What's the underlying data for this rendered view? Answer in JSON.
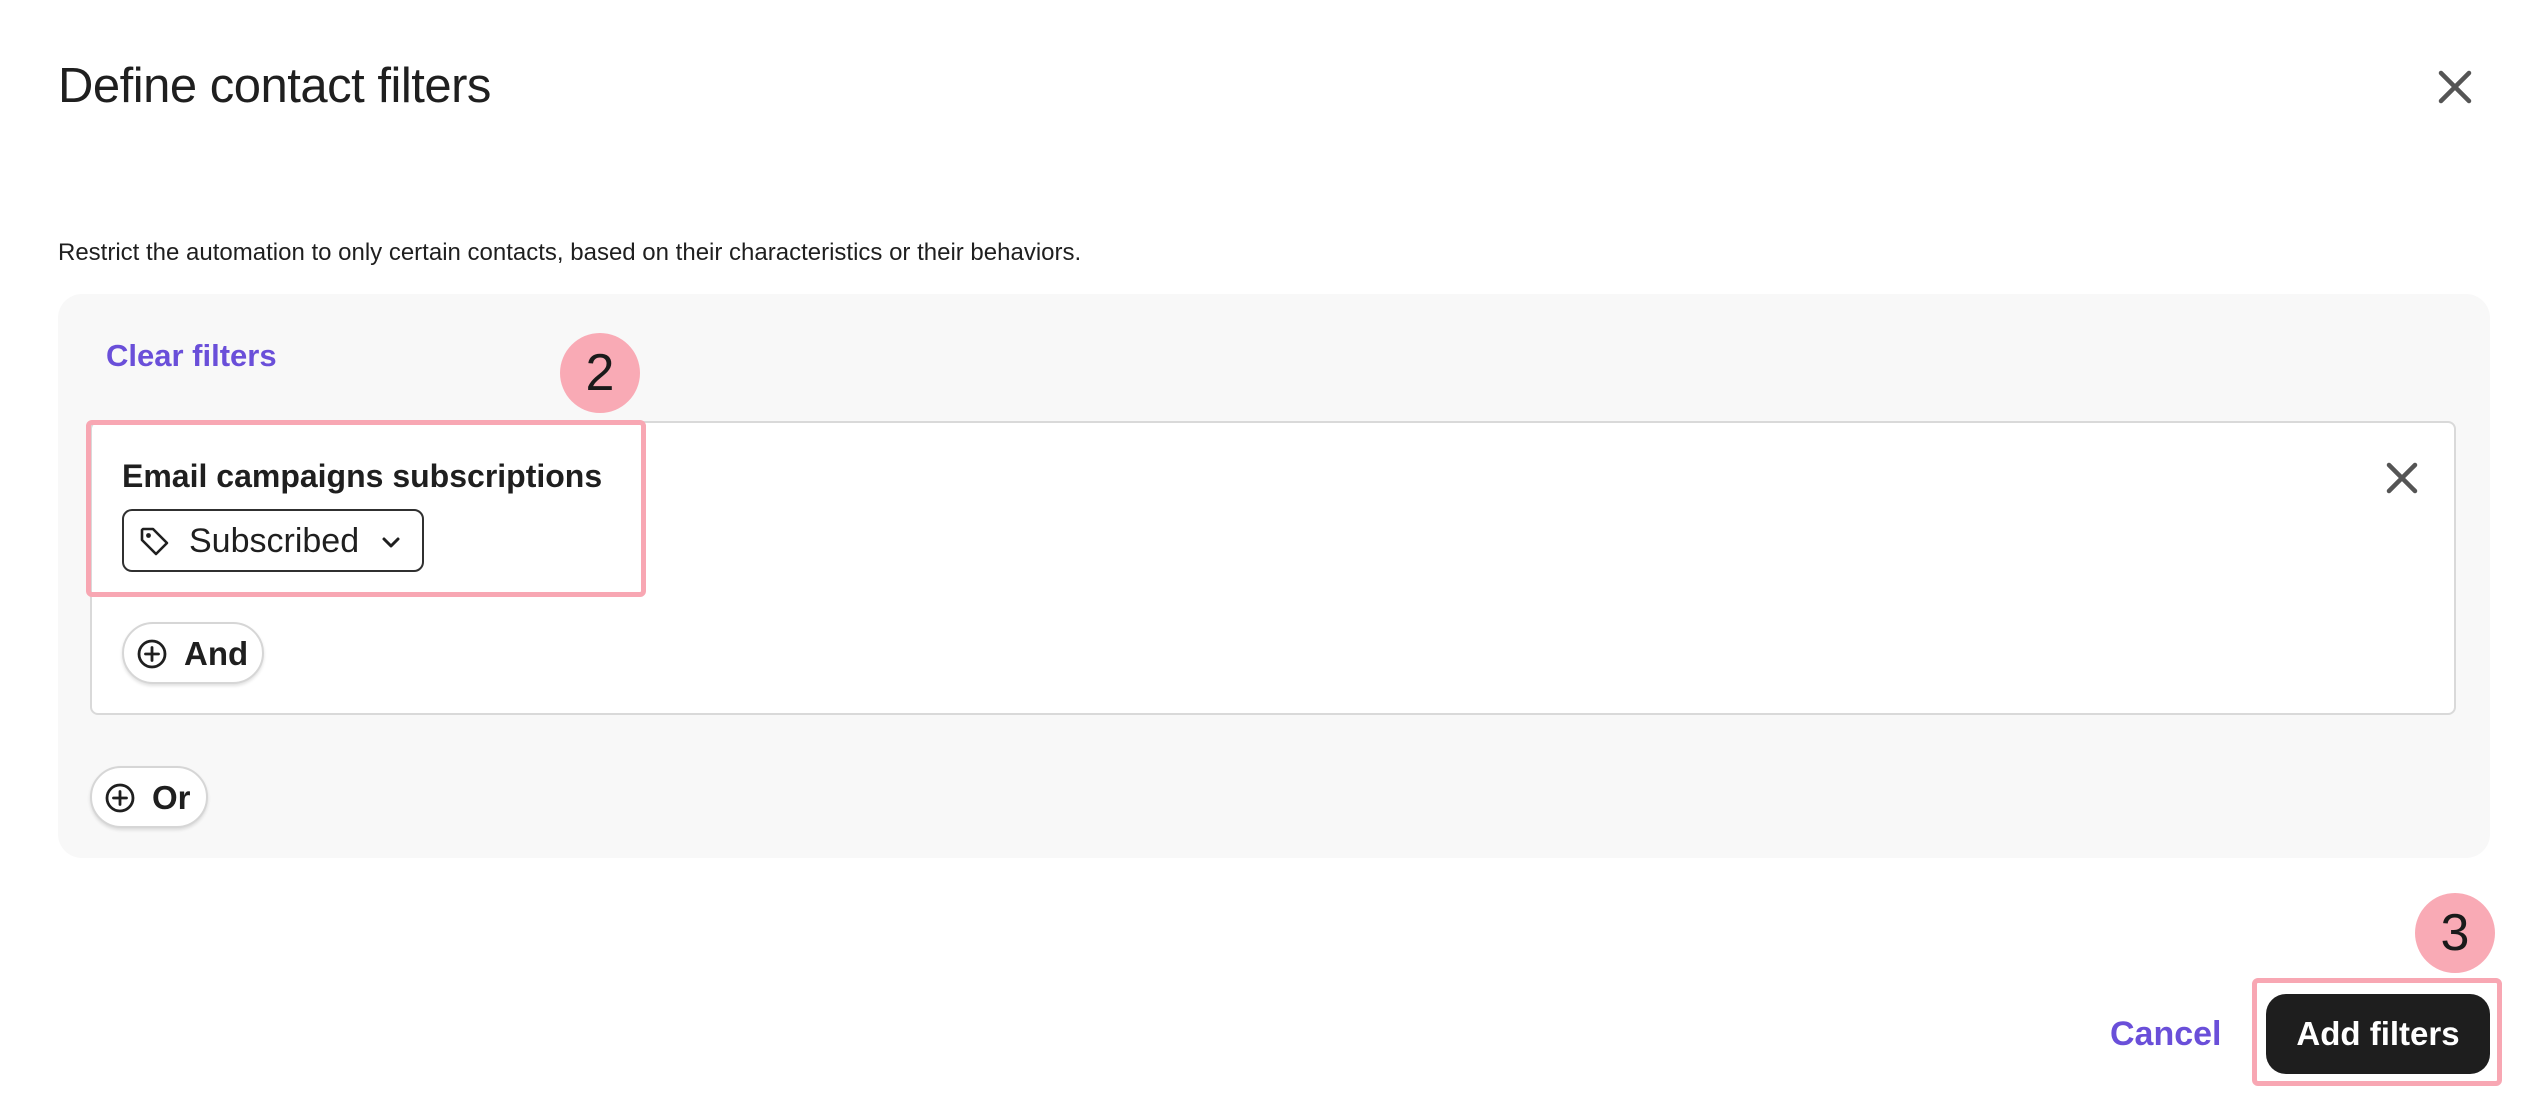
{
  "modal": {
    "title": "Define contact filters",
    "description": "Restrict the automation to only certain contacts, based on their characteristics or their behaviors."
  },
  "filters": {
    "clear_label": "Clear filters",
    "groups": [
      {
        "conditions": [
          {
            "title": "Email campaigns subscriptions",
            "value": "Subscribed",
            "value_icon": "tag-icon"
          }
        ],
        "and_label": "And"
      }
    ],
    "or_label": "Or"
  },
  "footer": {
    "cancel_label": "Cancel",
    "submit_label": "Add filters"
  },
  "annotations": {
    "badge_2": "2",
    "badge_3": "3"
  },
  "colors": {
    "accent": "#6a4fd9",
    "primary_button": "#1e1e1e",
    "panel_bg": "#f8f8f8",
    "highlight": "#f8a7b3"
  }
}
